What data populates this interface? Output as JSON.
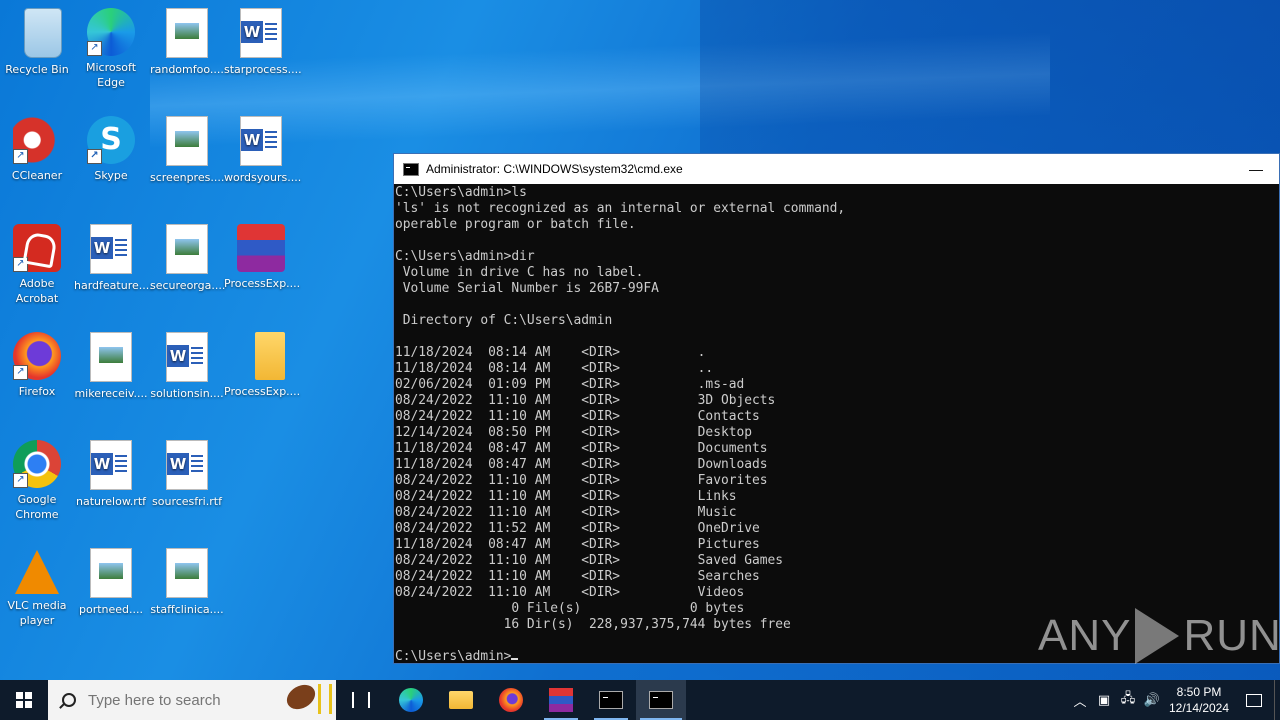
{
  "desktop_icons": [
    {
      "label": "Recycle Bin",
      "icon": "recycle-bin-icon"
    },
    {
      "label": "Microsoft Edge",
      "icon": "edge-icon"
    },
    {
      "label": "randomfoo....",
      "icon": "image-file-icon"
    },
    {
      "label": "starprocess....",
      "icon": "word-doc-icon"
    },
    {
      "label": "CCleaner",
      "icon": "ccleaner-icon"
    },
    {
      "label": "Skype",
      "icon": "skype-icon"
    },
    {
      "label": "screenpres....",
      "icon": "image-file-icon"
    },
    {
      "label": "wordsyours....",
      "icon": "word-doc-icon"
    },
    {
      "label": "Adobe Acrobat",
      "icon": "adobe-acrobat-icon"
    },
    {
      "label": "hardfeature....",
      "icon": "word-doc-icon"
    },
    {
      "label": "secureorga....",
      "icon": "image-file-icon"
    },
    {
      "label": "ProcessExp....",
      "icon": "winrar-icon"
    },
    {
      "label": "Firefox",
      "icon": "firefox-icon"
    },
    {
      "label": "mikereceiv....",
      "icon": "image-file-icon"
    },
    {
      "label": "solutionsin....",
      "icon": "word-doc-icon"
    },
    {
      "label": "ProcessExp....",
      "icon": "folder-icon"
    },
    {
      "label": "Google Chrome",
      "icon": "chrome-icon"
    },
    {
      "label": "naturelow.rtf",
      "icon": "word-doc-icon"
    },
    {
      "label": "sourcesfri.rtf",
      "icon": "word-doc-icon"
    },
    {
      "label": "VLC media player",
      "icon": "vlc-icon"
    },
    {
      "label": "portneed....",
      "icon": "image-file-icon"
    },
    {
      "label": "staffclinica....",
      "icon": "image-file-icon"
    }
  ],
  "cmd_window": {
    "title": "Administrator: C:\\WINDOWS\\system32\\cmd.exe",
    "minimize": "—",
    "output": "C:\\Users\\admin>ls\n'ls' is not recognized as an internal or external command,\noperable program or batch file.\n\nC:\\Users\\admin>dir\n Volume in drive C has no label.\n Volume Serial Number is 26B7-99FA\n\n Directory of C:\\Users\\admin\n\n11/18/2024  08:14 AM    <DIR>          .\n11/18/2024  08:14 AM    <DIR>          ..\n02/06/2024  01:09 PM    <DIR>          .ms-ad\n08/24/2022  11:10 AM    <DIR>          3D Objects\n08/24/2022  11:10 AM    <DIR>          Contacts\n12/14/2024  08:50 PM    <DIR>          Desktop\n11/18/2024  08:47 AM    <DIR>          Documents\n11/18/2024  08:47 AM    <DIR>          Downloads\n08/24/2022  11:10 AM    <DIR>          Favorites\n08/24/2022  11:10 AM    <DIR>          Links\n08/24/2022  11:10 AM    <DIR>          Music\n08/24/2022  11:52 AM    <DIR>          OneDrive\n11/18/2024  08:47 AM    <DIR>          Pictures\n08/24/2022  11:10 AM    <DIR>          Saved Games\n08/24/2022  11:10 AM    <DIR>          Searches\n08/24/2022  11:10 AM    <DIR>          Videos\n               0 File(s)              0 bytes\n              16 Dir(s)  228,937,375,744 bytes free\n\n",
    "prompt": "C:\\Users\\admin>"
  },
  "watermark": {
    "left": "ANY",
    "right": "RUN"
  },
  "taskbar": {
    "search_placeholder": "Type here to search",
    "apps": [
      "task-view-icon",
      "edge-icon",
      "file-explorer-icon",
      "firefox-icon",
      "winrar-icon",
      "cmd-icon",
      "cmd-icon"
    ],
    "tray_icons": [
      "chevron-up-icon",
      "meet-now-icon",
      "network-icon",
      "volume-icon"
    ],
    "time": "8:50 PM",
    "date": "12/14/2024"
  }
}
